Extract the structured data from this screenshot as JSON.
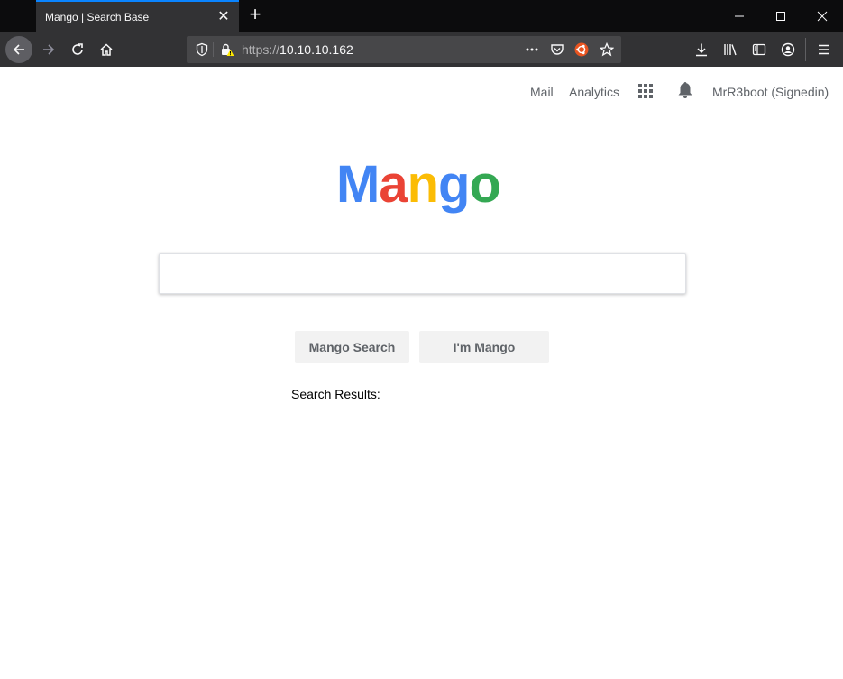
{
  "browser": {
    "tab": {
      "title": "Mango | Search Base"
    },
    "url": {
      "scheme": "https://",
      "host": "10.10.10.162"
    }
  },
  "header": {
    "mail": "Mail",
    "analytics": "Analytics",
    "user": "MrR3boot (Signedin)"
  },
  "logo": {
    "letters": [
      {
        "char": "M",
        "color": "#4285f4"
      },
      {
        "char": "a",
        "color": "#ea4335"
      },
      {
        "char": "n",
        "color": "#fbbc05"
      },
      {
        "char": "g",
        "color": "#4285f4"
      },
      {
        "char": "o",
        "color": "#34a853"
      }
    ]
  },
  "search": {
    "value": "",
    "primary_button": "Mango Search",
    "secondary_button": "I'm Mango",
    "results_label": "Search Results:"
  },
  "colors": {
    "chrome_dark": "#0c0c0d",
    "toolbar": "#323234",
    "accent": "#0a84ff"
  }
}
